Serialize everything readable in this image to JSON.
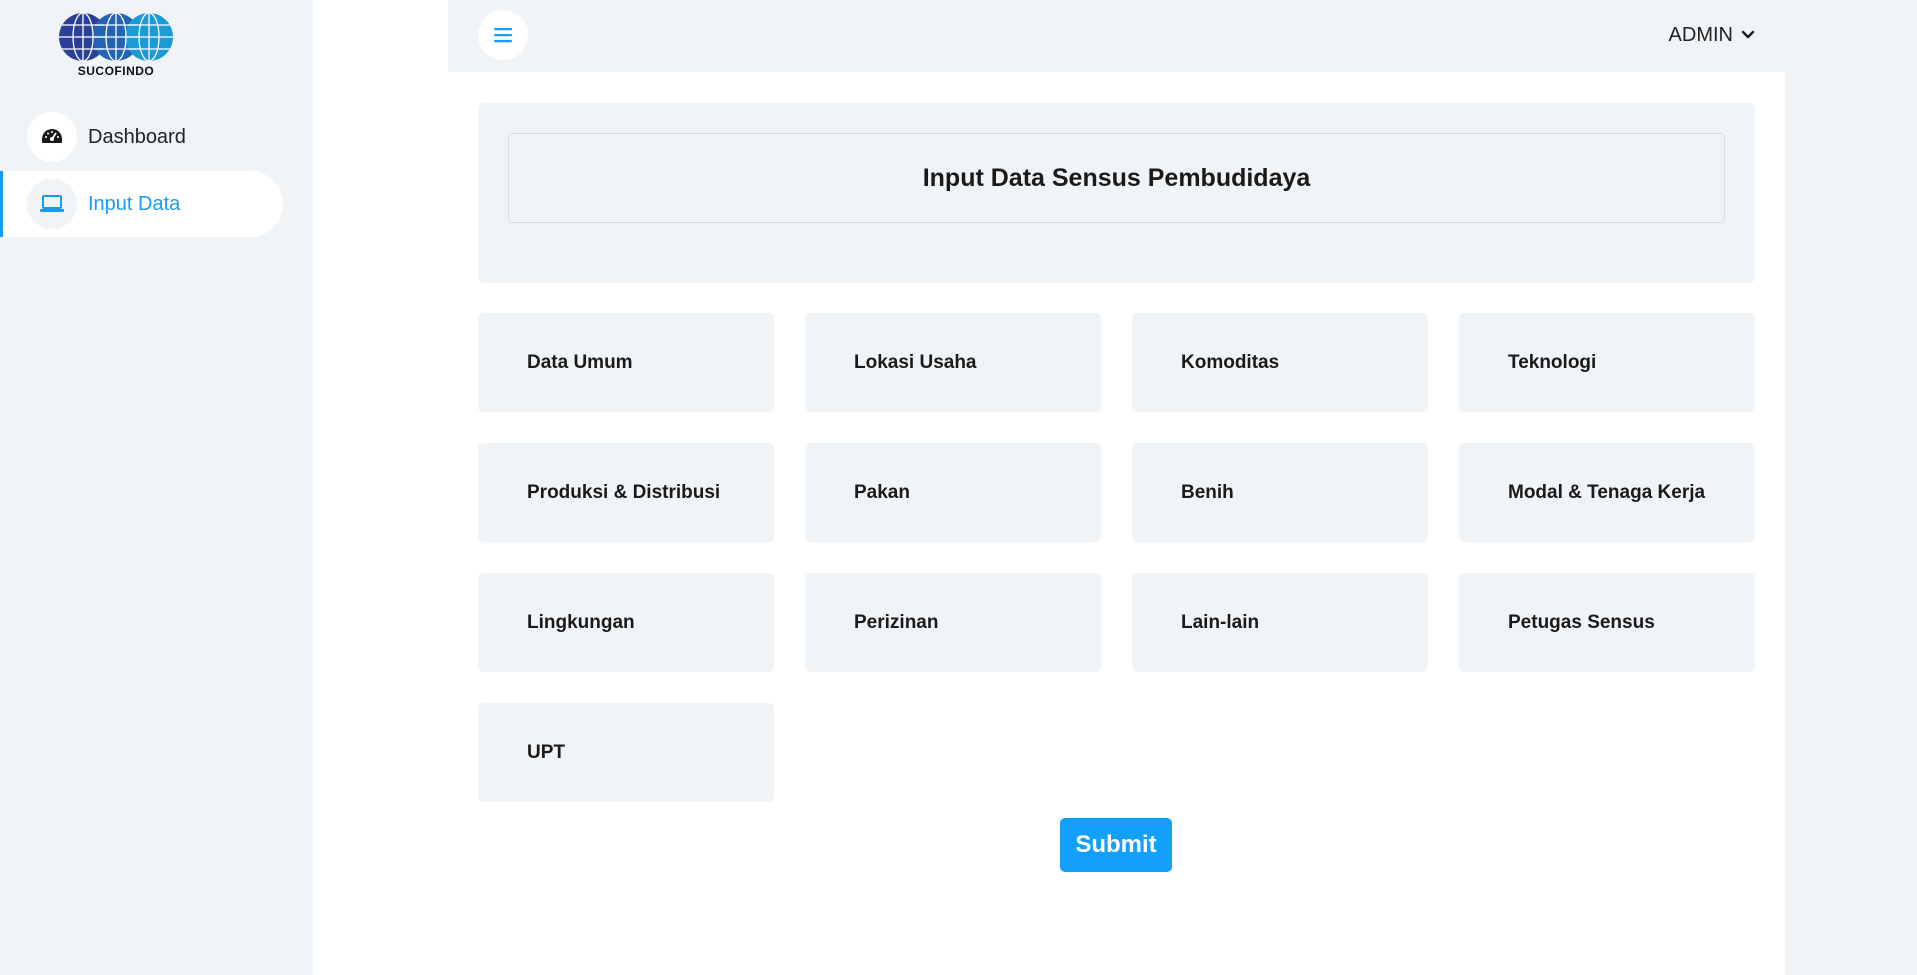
{
  "brand": {
    "name": "SUCOFINDO"
  },
  "sidebar": {
    "items": [
      {
        "label": "Dashboard",
        "icon": "dashboard-gauge-icon"
      },
      {
        "label": "Input Data",
        "icon": "laptop-icon"
      }
    ]
  },
  "header": {
    "user": "ADMIN"
  },
  "main": {
    "title": "Input Data Sensus Pembudidaya",
    "cards": [
      "Data Umum",
      "Lokasi Usaha",
      "Komoditas",
      "Teknologi",
      "Produksi & Distribusi",
      "Pakan",
      "Benih",
      "Modal & Tenaga Kerja",
      "Lingkungan",
      "Perizinan",
      "Lain-lain",
      "Petugas Sensus",
      "UPT"
    ],
    "submit_label": "Submit"
  },
  "colors": {
    "accent": "#1a9cf0",
    "submit": "#12a0fb",
    "panel": "#f1f4f7"
  }
}
